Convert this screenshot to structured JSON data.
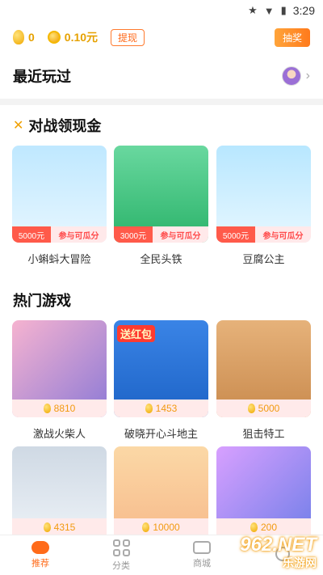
{
  "status": {
    "time": "3:29"
  },
  "top": {
    "beans": "0",
    "coins": "0.10元",
    "withdraw": "提现",
    "lottery": "抽奖"
  },
  "recent": {
    "title": "最近玩过"
  },
  "battle": {
    "title": "对战领现金",
    "join_label": "参与可瓜分",
    "games": [
      {
        "name": "小蝌蚪大冒险",
        "prize": "5000元"
      },
      {
        "name": "全民头铁",
        "prize": "3000元"
      },
      {
        "name": "豆腐公主",
        "prize": "5000元"
      }
    ]
  },
  "hot": {
    "title": "热门游戏",
    "games": [
      {
        "name": "激战火柴人",
        "count": "8810"
      },
      {
        "name": "破晓开心斗地主",
        "count": "1453",
        "badge": "送红包"
      },
      {
        "name": "狙击特工",
        "count": "5000"
      },
      {
        "name": "",
        "count": "4315"
      },
      {
        "name": "",
        "count": "10000"
      },
      {
        "name": "",
        "count": "200"
      }
    ]
  },
  "nav": {
    "items": [
      "推荐",
      "分类",
      "商城",
      ""
    ]
  },
  "watermark": {
    "main": "962.NET",
    "sub": "乐游网"
  }
}
